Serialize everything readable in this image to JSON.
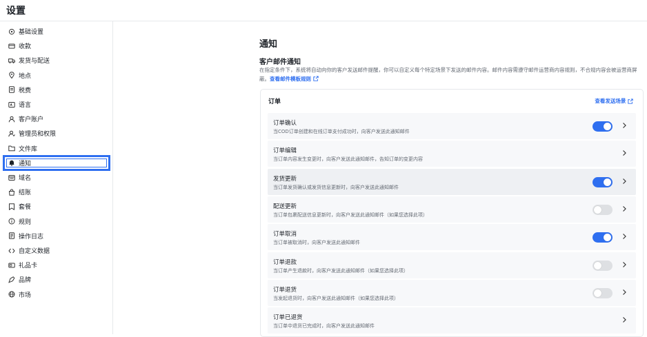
{
  "app": {
    "title": "设置"
  },
  "sidebar": {
    "items": [
      {
        "label": "基础设置",
        "icon": "settings-gear-icon"
      },
      {
        "label": "收款",
        "icon": "payment-card-icon"
      },
      {
        "label": "发货与配送",
        "icon": "truck-icon"
      },
      {
        "label": "地点",
        "icon": "location-pin-icon"
      },
      {
        "label": "税费",
        "icon": "receipt-icon"
      },
      {
        "label": "语言",
        "icon": "language-icon"
      },
      {
        "label": "客户账户",
        "icon": "user-icon"
      },
      {
        "label": "管理员和权限",
        "icon": "admin-user-icon"
      },
      {
        "label": "文件库",
        "icon": "folder-icon"
      },
      {
        "label": "通知",
        "icon": "bell-icon"
      },
      {
        "label": "域名",
        "icon": "domain-icon"
      },
      {
        "label": "结账",
        "icon": "shopping-bag-icon"
      },
      {
        "label": "套餐",
        "icon": "plan-icon"
      },
      {
        "label": "规则",
        "icon": "info-icon"
      },
      {
        "label": "操作日志",
        "icon": "log-icon"
      },
      {
        "label": "自定义数据",
        "icon": "custom-data-icon"
      },
      {
        "label": "礼品卡",
        "icon": "gift-card-icon"
      },
      {
        "label": "品牌",
        "icon": "brand-icon"
      },
      {
        "label": "市场",
        "icon": "globe-icon"
      }
    ],
    "active_index": 9
  },
  "main": {
    "page_title": "通知",
    "section_title": "客户邮件通知",
    "section_desc": "在指定条件下，系统将自动向你的客户发送邮件提醒，你可以自定义每个特定场景下发送的邮件内容。邮件内容需遵守邮件运营商内容规则，不合规内容会被运营商屏蔽。",
    "section_link": "查看邮件模板规则",
    "card": {
      "title": "订单",
      "link": "查看发送场景",
      "rows": [
        {
          "title": "订单确认",
          "desc": "当COD订单创建和在线订单支付成功时，向客户发送此通知邮件",
          "toggle": "on"
        },
        {
          "title": "订单编辑",
          "desc": "当订单内容发生变更时，向客户发送此通知邮件，告知订单的变更内容",
          "toggle": "none"
        },
        {
          "title": "发货更新",
          "desc": "当订单发货确认或发货信息更新时，向客户发送此通知邮件",
          "toggle": "on"
        },
        {
          "title": "配送更新",
          "desc": "当订单包裹配送信息更新时，向客户发送此通知邮件（如果您选择此项）",
          "toggle": "off"
        },
        {
          "title": "订单取消",
          "desc": "当订单被取消时，向客户发送此通知邮件",
          "toggle": "on"
        },
        {
          "title": "订单退款",
          "desc": "当订单产生退款时，向客户发送此通知邮件（如果您选择此项）",
          "toggle": "off"
        },
        {
          "title": "订单退货",
          "desc": "当发起退货时，向客户发送此通知邮件（如果您选择此项）",
          "toggle": "off"
        },
        {
          "title": "订单已退货",
          "desc": "当订单中退货已完成时，向客户发送此通知邮件",
          "toggle": "none"
        }
      ]
    }
  },
  "colors": {
    "accent": "#2f6ff0",
    "toggle_off": "#dee0e3",
    "row_bg": "#f7f8fa"
  }
}
